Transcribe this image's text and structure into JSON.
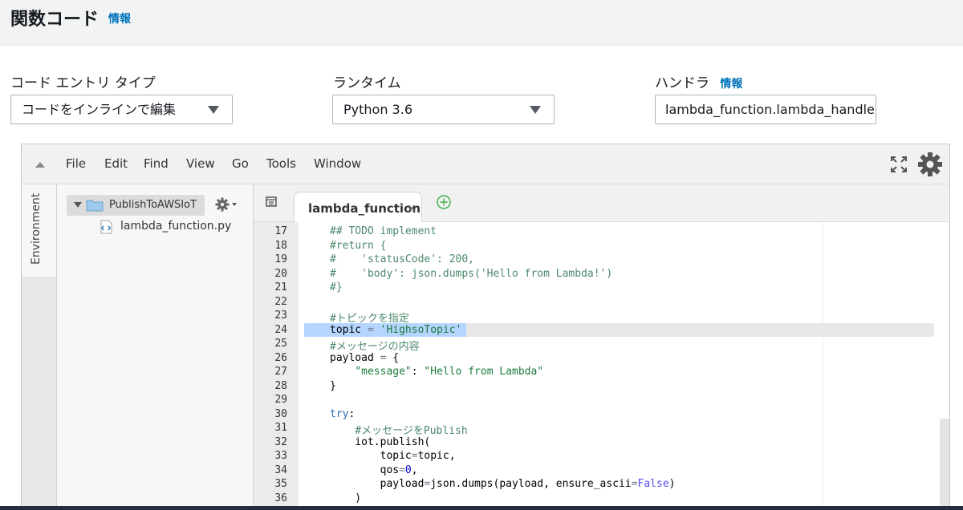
{
  "header": {
    "title": "関数コード",
    "info": "情報"
  },
  "fields": {
    "code_entry": {
      "label": "コード エントリ タイプ",
      "value": "コードをインラインで編集"
    },
    "runtime": {
      "label": "ランタイム",
      "value": "Python 3.6"
    },
    "handler": {
      "label": "ハンドラ",
      "info": "情報",
      "value": "lambda_function.lambda_handler"
    }
  },
  "ide": {
    "menu": [
      "File",
      "Edit",
      "Find",
      "View",
      "Go",
      "Tools",
      "Window"
    ],
    "side_tab": "Environment",
    "tree": {
      "root": "PublishToAWSIoT",
      "file": "lambda_function.py"
    },
    "tab": {
      "label": "lambda_function",
      "close": "×"
    },
    "active_line": 24,
    "lines": [
      {
        "n": "17",
        "t": "## TODO implement"
      },
      {
        "n": "18",
        "t": "#return {"
      },
      {
        "n": "19",
        "t": "#    'statusCode': 200,"
      },
      {
        "n": "20",
        "t": "#    'body': json.dumps('Hello from Lambda!')"
      },
      {
        "n": "21",
        "t": "#}"
      },
      {
        "n": "22",
        "t": ""
      },
      {
        "n": "23",
        "t": "#トピックを指定"
      },
      {
        "n": "24",
        "t": "topic = 'HighsoTopic'"
      },
      {
        "n": "25",
        "t": "#メッセージの内容"
      },
      {
        "n": "26",
        "t": "payload = {"
      },
      {
        "n": "27",
        "t": "    \"message\": \"Hello from Lambda\""
      },
      {
        "n": "28",
        "t": "}"
      },
      {
        "n": "29",
        "t": ""
      },
      {
        "n": "30",
        "t": "try:"
      },
      {
        "n": "31",
        "t": "    #メッセージをPublish"
      },
      {
        "n": "32",
        "t": "    iot.publish("
      },
      {
        "n": "33",
        "t": "        topic=topic,"
      },
      {
        "n": "34",
        "t": "        qos=0,"
      },
      {
        "n": "35",
        "t": "        payload=json.dumps(payload, ensure_ascii=False)"
      },
      {
        "n": "36",
        "t": "    )"
      }
    ]
  },
  "colors": {
    "link": "#0073bb",
    "selection": "#b5d5ff",
    "comment": "#4c886b",
    "keyword": "#2a6db5"
  }
}
